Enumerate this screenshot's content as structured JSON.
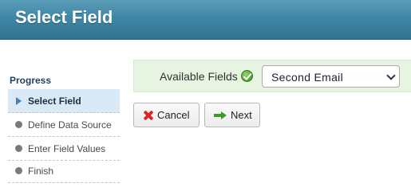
{
  "header": {
    "title": "Select Field"
  },
  "progress": {
    "heading": "Progress",
    "steps": [
      {
        "label": "Select Field",
        "state": "active",
        "icon": "triangle-right-icon"
      },
      {
        "label": "Define Data Source",
        "state": "pending",
        "icon": "dot-icon"
      },
      {
        "label": "Enter Field Values",
        "state": "pending",
        "icon": "dot-icon"
      },
      {
        "label": "Finish",
        "state": "pending",
        "icon": "dot-icon"
      }
    ]
  },
  "field_row": {
    "label": "Available Fields",
    "status_icon": "check-icon",
    "selected_value": "Second Email"
  },
  "buttons": {
    "cancel_label": "Cancel",
    "next_label": "Next"
  },
  "colors": {
    "header_bg": "#3f87a6",
    "active_step_bg": "#d9e9f6",
    "field_row_bg": "#e6f4e1",
    "cancel_icon": "#d92626",
    "next_icon": "#3c9a2a"
  }
}
